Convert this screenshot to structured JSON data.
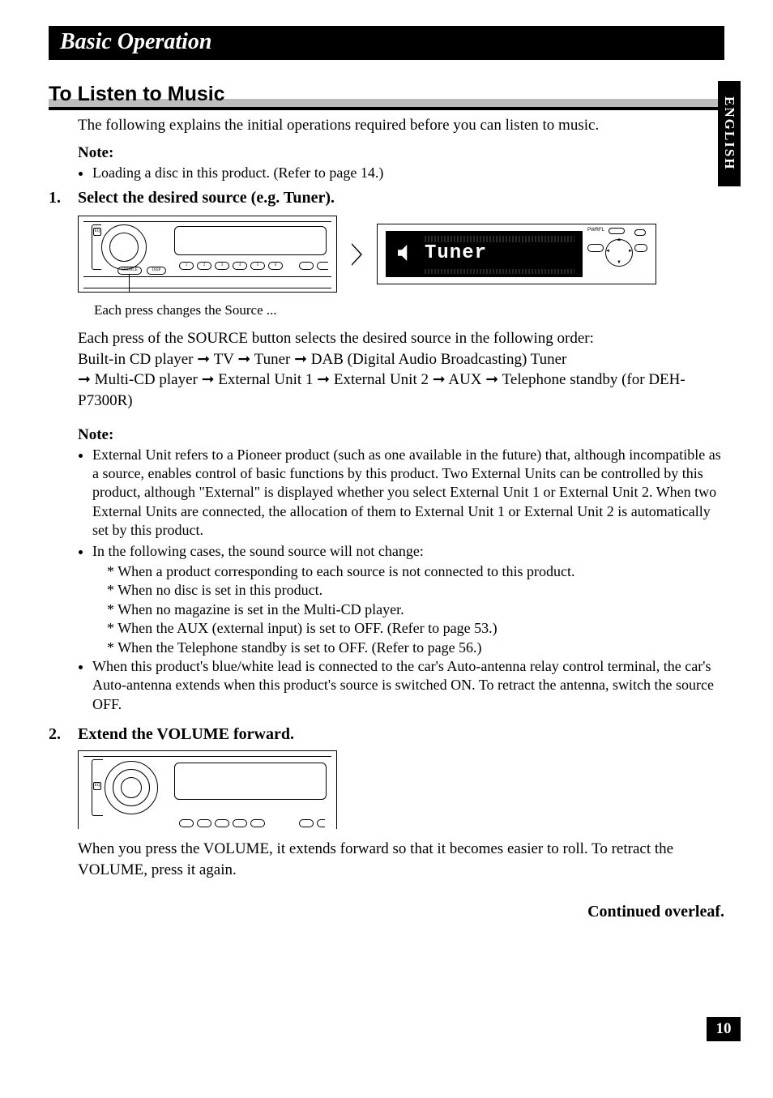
{
  "chapter": "Basic Operation",
  "section": "To Listen to Music",
  "lang_tab": "ENGLISH",
  "page_number": "10",
  "intro": "The following explains the initial operations required before you can listen to music.",
  "note1_label": "Note:",
  "note1_bullets": [
    "Loading a disc in this product. (Refer to page 14.)"
  ],
  "step1_num": "1.",
  "step1_text": "Select the desired source (e.g. Tuner).",
  "fig1": {
    "eq_label": "EQ",
    "preset_labels": [
      "1",
      "2",
      "3",
      "4",
      "5",
      "6"
    ],
    "source_label": "SOURCE",
    "disp_label": "DISP",
    "lcd_text": "Tuner",
    "pwr_label": "PWRFL"
  },
  "caption1": "Each press changes the Source ...",
  "source_seq_intro": "Each press of the SOURCE button selects the desired source in the following order:",
  "source_seq": [
    "Built-in CD player",
    "TV",
    "Tuner",
    "DAB (Digital Audio Broadcasting) Tuner",
    "Multi-CD player",
    "External Unit 1",
    "External Unit 2",
    "AUX",
    "Telephone standby (for DEH-P7300R)"
  ],
  "note2_label": "Note:",
  "note2_bullets": [
    "External Unit refers to a Pioneer product (such as one available in the future) that, although incompatible as a source, enables control of basic functions by this product. Two External Units can be controlled by this product, although \"External\" is displayed whether you select External Unit 1 or External Unit 2. When two External Units are connected, the allocation of them to External Unit 1 or External Unit 2 is automatically set by this product.",
    "In the following cases, the sound source will not change:"
  ],
  "note2_sub": [
    "When a product corresponding to each source is not connected to this product.",
    "When no disc is set in this product.",
    "When no magazine is set in the Multi-CD player.",
    "When the AUX (external input) is set to OFF. (Refer to page 53.)",
    "When the Telephone standby is set to OFF. (Refer to page 56.)"
  ],
  "note2_bullets_after": [
    "When this product's blue/white lead is connected to the car's Auto-antenna relay control terminal, the car's Auto-antenna extends when this product's source is switched ON. To retract the antenna, switch the source OFF."
  ],
  "step2_num": "2.",
  "step2_text": "Extend the VOLUME forward.",
  "fig2": {
    "eq_label": "EQ"
  },
  "volume_para": "When you press the VOLUME, it extends forward so that it becomes easier to roll. To retract the VOLUME, press it again.",
  "continued": "Continued overleaf."
}
